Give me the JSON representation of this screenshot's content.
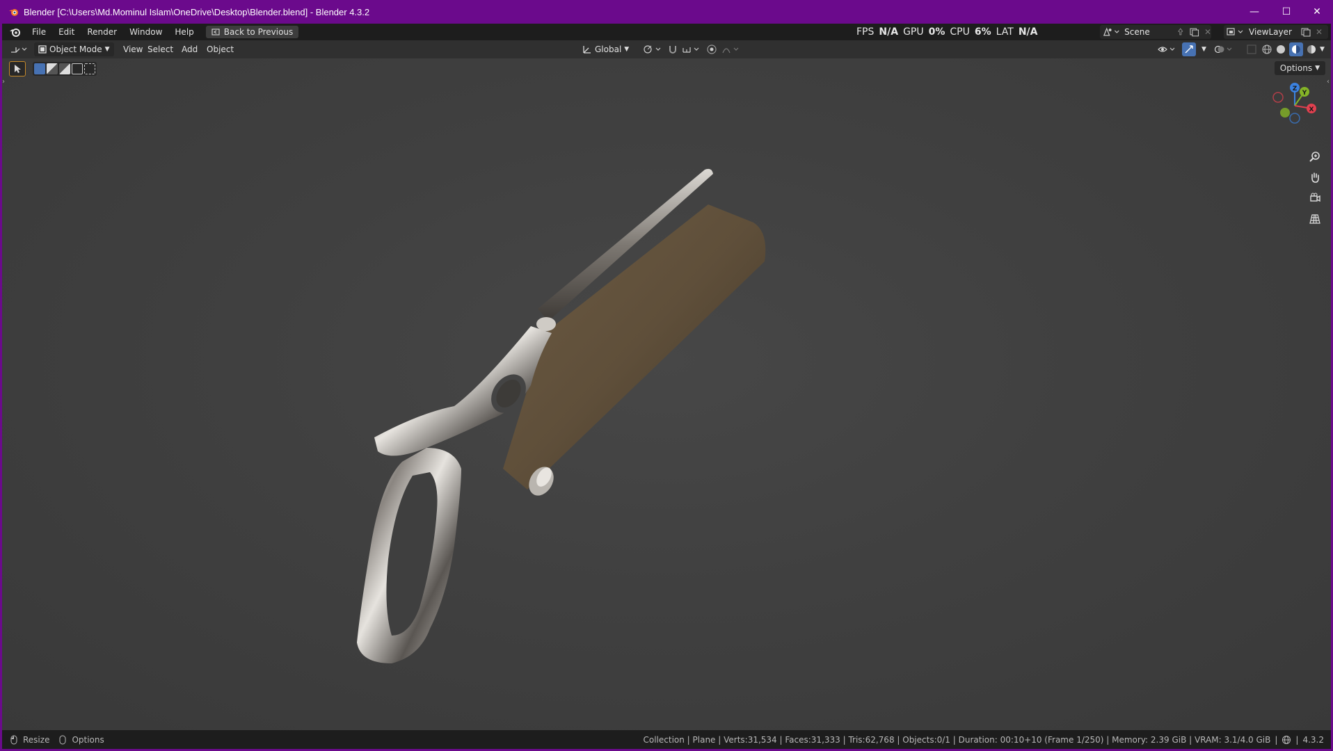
{
  "window": {
    "title": "Blender [C:\\Users\\Md.Mominul Islam\\OneDrive\\Desktop\\Blender.blend] - Blender 4.3.2",
    "controls": {
      "minimize": "—",
      "maximize": "☐",
      "close": "✕"
    }
  },
  "menubar": {
    "items": [
      "File",
      "Edit",
      "Render",
      "Window",
      "Help"
    ],
    "back_label": "Back to Previous",
    "perf": {
      "fps_label": "FPS",
      "fps_value": "N/A",
      "gpu_label": "GPU",
      "gpu_value": "0%",
      "cpu_label": "CPU",
      "cpu_value": "6%",
      "lat_label": "LAT",
      "lat_value": "N/A"
    },
    "scene": "Scene",
    "view_layer": "ViewLayer"
  },
  "header": {
    "mode": "Object Mode",
    "menus": [
      "View",
      "Select",
      "Add",
      "Object"
    ],
    "transform_orientation": "Global",
    "options_label": "Options"
  },
  "gizmo": {
    "z": "Z",
    "y": "Y",
    "x": "X"
  },
  "statusbar": {
    "left": {
      "resize": "Resize",
      "options": "Options"
    },
    "info": "Collection | Plane | Verts:31,534 | Faces:31,333 | Tris:62,768 | Objects:0/1 | Duration: 00:10+10 (Frame 1/250) | Memory: 2.39 GiB | VRAM: 3.1/4.0 GiB",
    "version": "4.3.2"
  },
  "colors": {
    "title_bar": "#6b0a8c",
    "accent": "#4772b3",
    "axis_x": "#e2404f",
    "axis_y": "#84b427",
    "axis_z": "#3b82e0"
  }
}
